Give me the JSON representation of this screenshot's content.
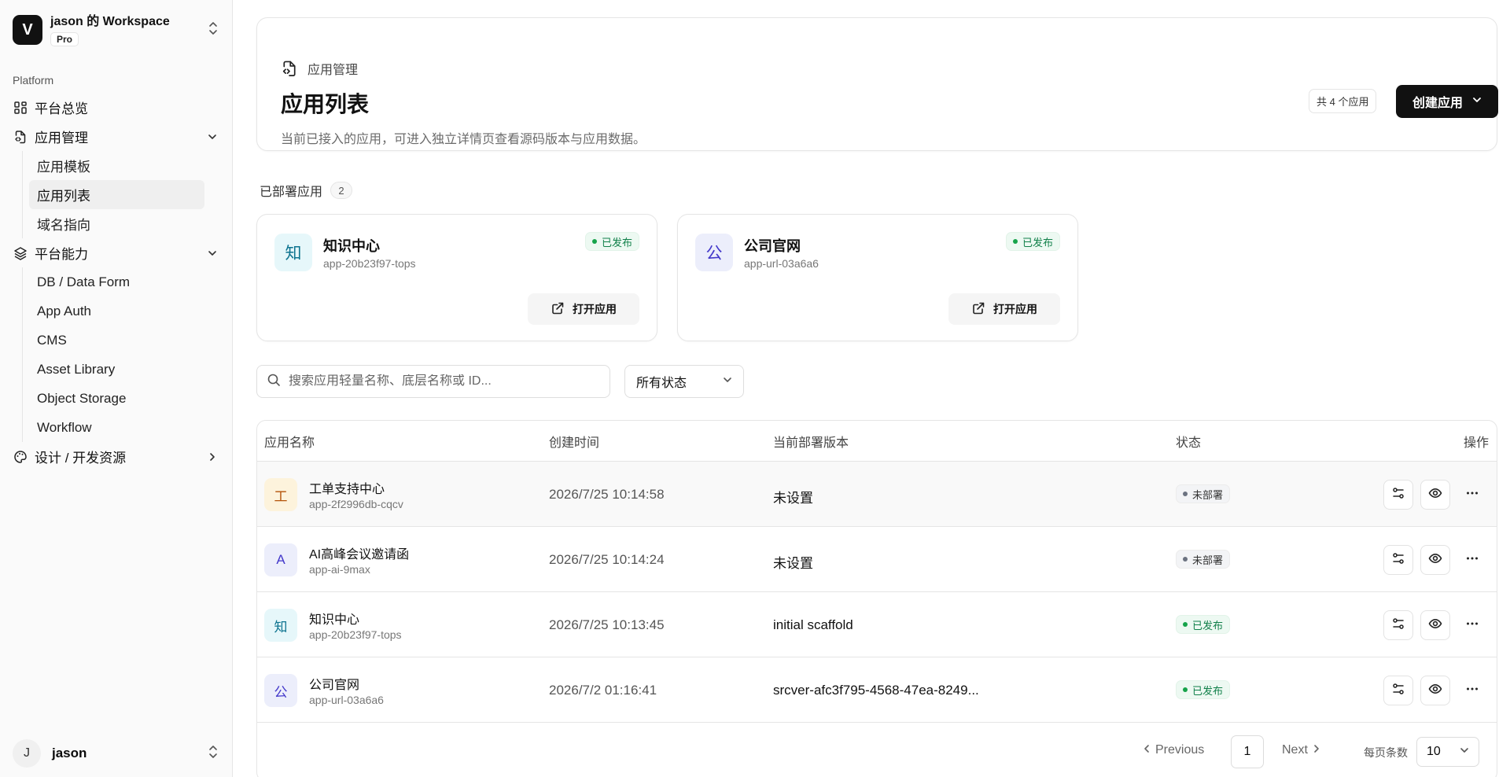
{
  "workspace": {
    "logo": "V",
    "name": "jason 的 Workspace",
    "plan": "Pro"
  },
  "sidebar": {
    "group_label": "Platform",
    "items": [
      {
        "label": "平台总览",
        "icon": "dashboard-icon"
      },
      {
        "label": "应用管理",
        "icon": "app-file-icon",
        "expanded": true,
        "children": [
          {
            "label": "应用模板"
          },
          {
            "label": "应用列表",
            "active": true
          },
          {
            "label": "域名指向"
          }
        ]
      },
      {
        "label": "平台能力",
        "icon": "layers-icon",
        "expanded": true,
        "children": [
          {
            "label": "DB / Data Form"
          },
          {
            "label": "App Auth"
          },
          {
            "label": "CMS"
          },
          {
            "label": "Asset Library"
          },
          {
            "label": "Object Storage"
          },
          {
            "label": "Workflow"
          }
        ]
      },
      {
        "label": "设计 / 开发资源",
        "icon": "palette-icon",
        "expanded": false
      }
    ],
    "user": {
      "initial": "J",
      "name": "jason"
    }
  },
  "header": {
    "breadcrumb": "应用管理",
    "title": "应用列表",
    "description": "当前已接入的应用，可进入独立详情页查看源码版本与应用数据。",
    "count_badge": "共 4 个应用",
    "create_button": "创建应用"
  },
  "deployed": {
    "label": "已部署应用",
    "count": "2",
    "cards": [
      {
        "avatar": "知",
        "name": "知识中心",
        "id": "app-20b23f97-tops",
        "status": "已发布",
        "open_label": "打开应用",
        "avatar_bg": "#e6f7fa",
        "avatar_fg": "#0e7490"
      },
      {
        "avatar": "公",
        "name": "公司官网",
        "id": "app-url-03a6a6",
        "status": "已发布",
        "open_label": "打开应用",
        "avatar_bg": "#eceefb",
        "avatar_fg": "#4338ca"
      }
    ]
  },
  "filters": {
    "search_placeholder": "搜索应用轻量名称、底层名称或 ID...",
    "status_select": "所有状态"
  },
  "table": {
    "columns": [
      "应用名称",
      "创建时间",
      "当前部署版本",
      "状态",
      "操作"
    ],
    "rows": [
      {
        "avatar": "工",
        "name": "工单支持中心",
        "id": "app-2f2996db-cqcv",
        "created": "2026/7/25 10:14:58",
        "version": "未设置",
        "status": "未部署",
        "status_type": "gray",
        "avatar_bg": "#fdf3dc",
        "avatar_fg": "#b45309"
      },
      {
        "avatar": "A",
        "name": "AI高峰会议邀请函",
        "id": "app-ai-9max",
        "created": "2026/7/25 10:14:24",
        "version": "未设置",
        "status": "未部署",
        "status_type": "gray",
        "avatar_bg": "#eceefb",
        "avatar_fg": "#4338ca"
      },
      {
        "avatar": "知",
        "name": "知识中心",
        "id": "app-20b23f97-tops",
        "created": "2026/7/25 10:13:45",
        "version": "initial scaffold",
        "status": "已发布",
        "status_type": "green",
        "avatar_bg": "#e6f7fa",
        "avatar_fg": "#0e7490"
      },
      {
        "avatar": "公",
        "name": "公司官网",
        "id": "app-url-03a6a6",
        "created": "2026/7/2 01:16:41",
        "version": "srcver-afc3f795-4568-47ea-8249...",
        "status": "已发布",
        "status_type": "green",
        "avatar_bg": "#eceefb",
        "avatar_fg": "#4338ca"
      }
    ]
  },
  "pagination": {
    "previous": "Previous",
    "page": "1",
    "next": "Next",
    "page_size_label": "每页条数",
    "page_size": "10"
  }
}
